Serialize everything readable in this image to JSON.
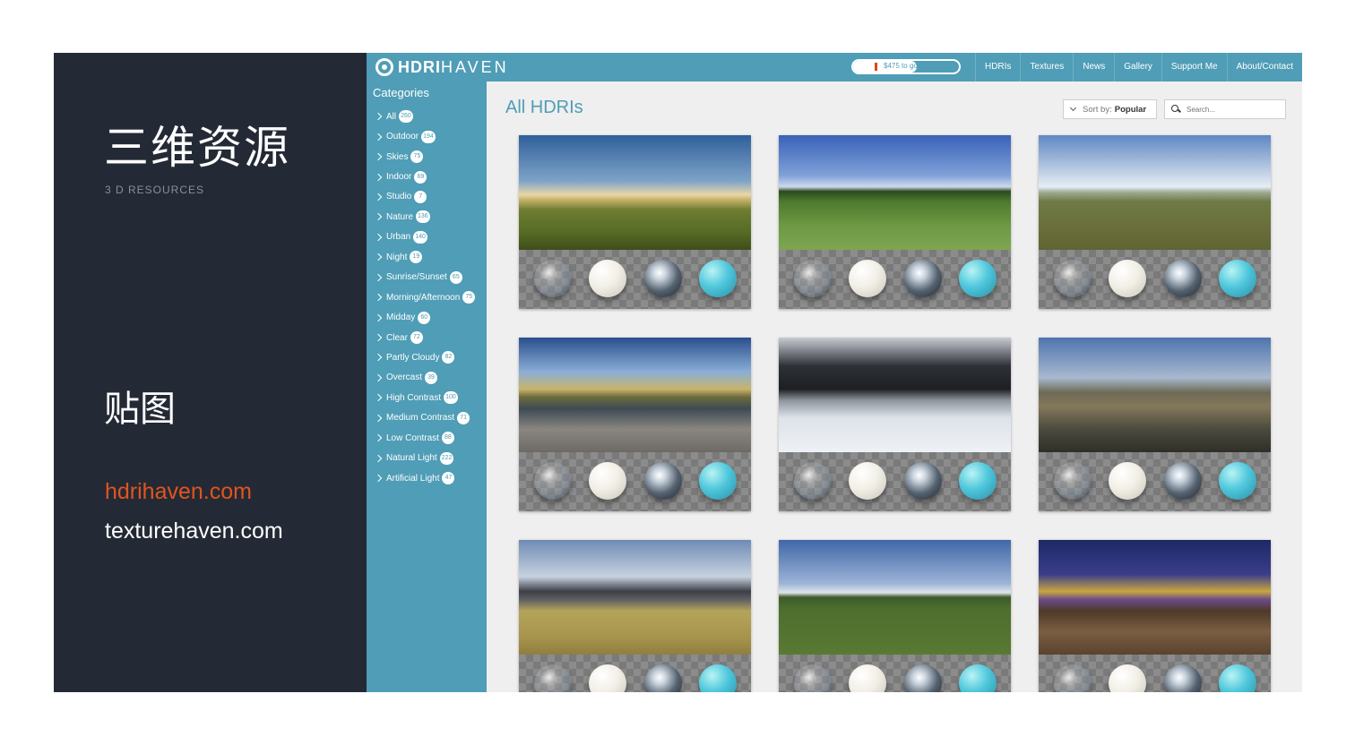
{
  "slide": {
    "title": "三维资源",
    "subtitle": "3 D RESOURCES",
    "section": "贴图",
    "link_primary": "hdrihaven.com",
    "link_secondary": "texturehaven.com",
    "colors": {
      "panel": "#232a35",
      "accent": "#e2541e"
    }
  },
  "site": {
    "logo_bold": "HDRI",
    "logo_light": "HAVEN",
    "goal_text": "$475 to go",
    "goal_progress": 0.6,
    "nav": [
      "HDRIs",
      "Textures",
      "News",
      "Gallery",
      "Support Me",
      "About/Contact"
    ],
    "categories_title": "Categories",
    "categories": [
      {
        "label": "All",
        "count": "260"
      },
      {
        "label": "Outdoor",
        "count": "194"
      },
      {
        "label": "Skies",
        "count": "75"
      },
      {
        "label": "Indoor",
        "count": "69"
      },
      {
        "label": "Studio",
        "count": "7"
      },
      {
        "label": "Nature",
        "count": "136"
      },
      {
        "label": "Urban",
        "count": "140"
      },
      {
        "label": "Night",
        "count": "19"
      },
      {
        "label": "Sunrise/Sunset",
        "count": "65"
      },
      {
        "label": "Morning/Afternoon",
        "count": "75"
      },
      {
        "label": "Midday",
        "count": "60"
      },
      {
        "label": "Clear",
        "count": "72"
      },
      {
        "label": "Partly Cloudy",
        "count": "82"
      },
      {
        "label": "Overcast",
        "count": "39"
      },
      {
        "label": "High Contrast",
        "count": "100"
      },
      {
        "label": "Medium Contrast",
        "count": "71"
      },
      {
        "label": "Low Contrast",
        "count": "88"
      },
      {
        "label": "Natural Light",
        "count": "222"
      },
      {
        "label": "Artificial Light",
        "count": "47"
      }
    ],
    "page_title": "All HDRIs",
    "sort_prefix": "Sort by:",
    "sort_value": "Popular",
    "search_placeholder": "Search...",
    "accent_color": "#4f9db6"
  }
}
